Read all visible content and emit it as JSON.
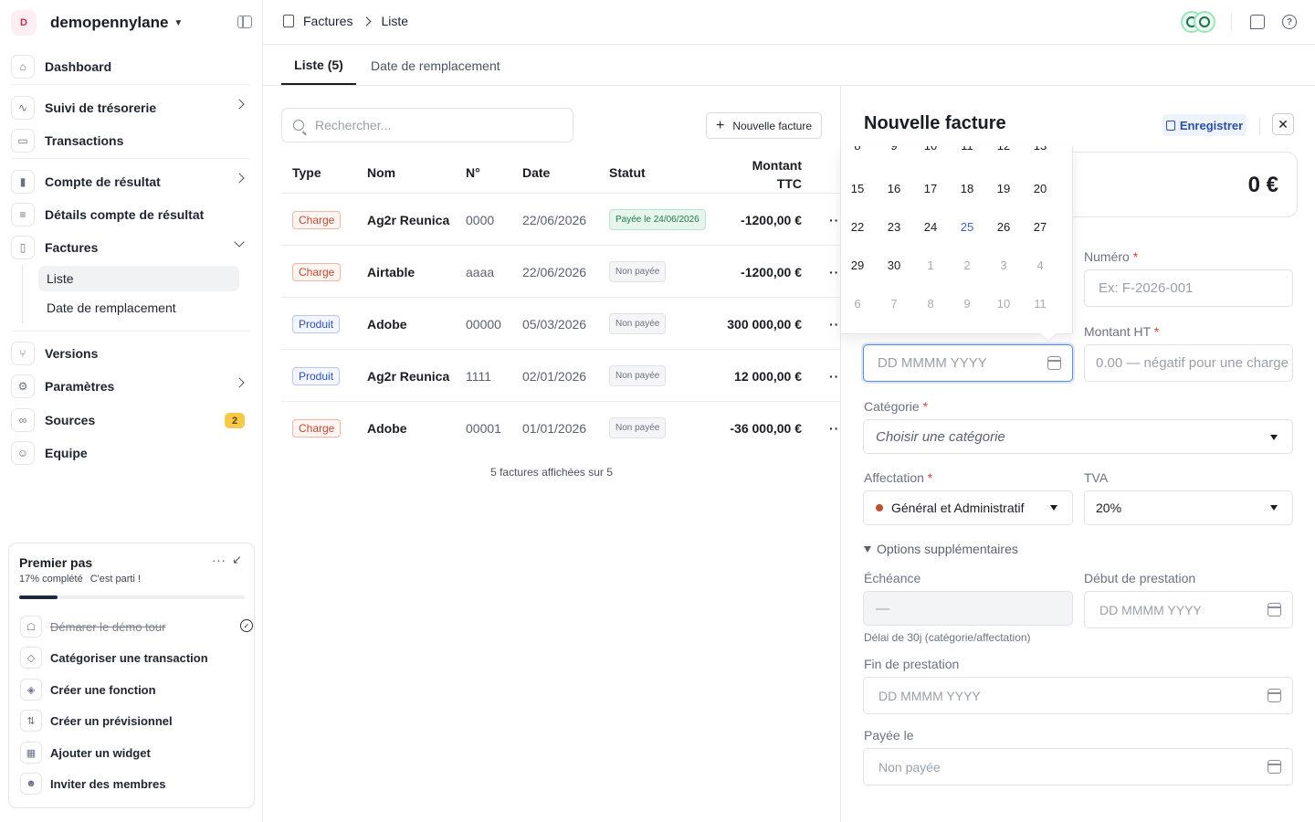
{
  "org": {
    "badge": "D",
    "name": "demopennylane"
  },
  "sidebar": {
    "items": [
      {
        "label": "Dashboard",
        "icon": "home-icon"
      },
      {
        "label": "Suivi de trésorerie",
        "icon": "chart-icon"
      },
      {
        "label": "Transactions",
        "icon": "card-icon"
      },
      {
        "label": "Compte de résultat",
        "icon": "bar-icon"
      },
      {
        "label": "Détails compte de résultat",
        "icon": "list-icon"
      },
      {
        "label": "Factures",
        "icon": "doc-icon"
      },
      {
        "label": "Versions",
        "icon": "branch-icon"
      },
      {
        "label": "Paramètres",
        "icon": "gear-icon"
      },
      {
        "label": "Sources",
        "icon": "link-icon",
        "badge": "2"
      },
      {
        "label": "Equipe",
        "icon": "user-icon"
      }
    ],
    "sub_items": [
      {
        "label": "Liste"
      },
      {
        "label": "Date de remplacement"
      }
    ]
  },
  "premier": {
    "title": "Premier pas",
    "dots": "···",
    "minimize": "↙",
    "progress_text": "17% complété",
    "cheer": "C'est parti !",
    "progress": 0.17,
    "tasks": [
      {
        "label": "Démarer le démo tour",
        "done": true
      },
      {
        "label": "Catégoriser une transaction",
        "done": false
      },
      {
        "label": "Créer une fonction",
        "done": false
      },
      {
        "label": "Créer un prévisionnel",
        "done": false
      },
      {
        "label": "Ajouter un widget",
        "done": false
      },
      {
        "label": "Inviter des membres",
        "done": false
      }
    ]
  },
  "breadcrumb": {
    "root": "Factures",
    "current": "Liste"
  },
  "tabs": [
    {
      "label": "Liste (5)"
    },
    {
      "label": "Date de remplacement"
    }
  ],
  "search": {
    "placeholder": "Rechercher..."
  },
  "new_invoice_label": "Nouvelle facture",
  "table": {
    "headers": {
      "type": "Type",
      "nom": "Nom",
      "num": "N°",
      "date": "Date",
      "statut": "Statut",
      "montant_1": "Montant",
      "montant_2": "TTC"
    },
    "rows": [
      {
        "type": "Charge",
        "nom": "Ag2r Reunica",
        "num": "0000",
        "date": "22/06/2026",
        "statut": "Payée le 24/06/2026",
        "paid": true,
        "montant": "-1200,00 €",
        "more": "···"
      },
      {
        "type": "Charge",
        "nom": "Airtable",
        "num": "aaaa",
        "date": "22/06/2026",
        "statut": "Non payée",
        "paid": false,
        "montant": "-1200,00 €",
        "more": "···"
      },
      {
        "type": "Produit",
        "nom": "Adobe",
        "num": "00000",
        "date": "05/03/2026",
        "statut": "Non payée",
        "paid": false,
        "montant": "300 000,00 €",
        "more": "···"
      },
      {
        "type": "Produit",
        "nom": "Ag2r Reunica",
        "num": "1111",
        "date": "02/01/2026",
        "statut": "Non payée",
        "paid": false,
        "montant": "12 000,00 €",
        "more": "···"
      },
      {
        "type": "Charge",
        "nom": "Adobe",
        "num": "00001",
        "date": "01/01/2026",
        "statut": "Non payée",
        "paid": false,
        "montant": "-36 000,00 €",
        "more": "···"
      }
    ],
    "footer": "5 factures affichées sur 5"
  },
  "drawer": {
    "title": "Nouvelle facture",
    "save_label": "Enregistrer",
    "close": "✕",
    "amount": "0 €",
    "numero_label": "Numéro",
    "numero_placeholder": "Ex: F-2026-001",
    "date_placeholder": "DD MMMM YYYY",
    "montant_ht_label": "Montant HT",
    "montant_ht_placeholder": "0.00 — négatif pour une charge",
    "categorie_label": "Catégorie",
    "categorie_placeholder": "Choisir une catégorie",
    "affectation_label": "Affectation",
    "affectation_value": "Général et Administratif",
    "affectation_color": "#c0502d",
    "tva_label": "TVA",
    "tva_value": "20%",
    "options_label": "Options supplémentaires",
    "echeance_label": "Échéance",
    "echeance_value": "—",
    "debut_label": "Début de prestation",
    "debut_placeholder": "DD MMMM YYYY",
    "delai_hint": "Délai de 30j (catégorie/affectation)",
    "fin_label": "Fin de prestation",
    "fin_placeholder": "DD MMMM YYYY",
    "payee_label": "Payée le",
    "payee_placeholder": "Non payée",
    "required_mark": "*"
  },
  "calendar": {
    "weeks": [
      [
        "15",
        "16",
        "17",
        "18",
        "19",
        "20"
      ],
      [
        "22",
        "23",
        "24",
        "25",
        "26",
        "27"
      ],
      [
        "29",
        "30",
        "1",
        "2",
        "3",
        "4"
      ],
      [
        "6",
        "7",
        "8",
        "9",
        "10",
        "11"
      ]
    ],
    "today": "25"
  }
}
